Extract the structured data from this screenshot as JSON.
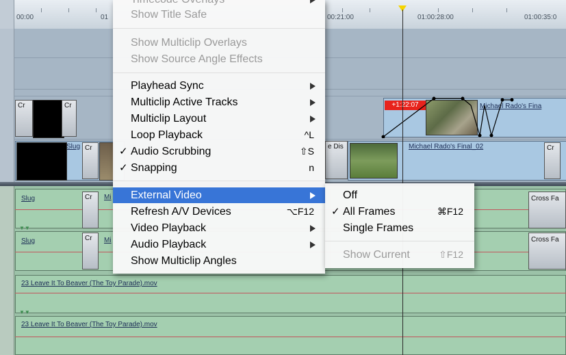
{
  "timeline": {
    "ruler_labels": [
      "00:00",
      "01",
      "00:21:00",
      "01:00:28:00",
      "01:00:35:0"
    ],
    "video_clips": {
      "cr1": "Cr",
      "cr2": "Cr",
      "slug": "Slug",
      "cr3": "Cr",
      "dis": "e Dis",
      "rado1": "Michael Rado's Fina",
      "rado2": "Michael Rado's Final_02",
      "cr4": "Cr",
      "timecode_badge": "+1:22:07"
    },
    "audio_clips": {
      "slug1": "Slug",
      "slug2": "Slug",
      "cr1": "Cr",
      "cr2": "Cr",
      "mi1": "Mi",
      "mi2": "Mi",
      "cross1": "Cross Fa",
      "cross2": "Cross Fa",
      "beaver1": "23 Leave It To Beaver (The Toy Parade).mov",
      "beaver2": "23 Leave It To Beaver (The Toy Parade).mov"
    }
  },
  "view_menu": {
    "partial_top": "Timecode Overlays",
    "items": [
      {
        "label": "Show Title Safe",
        "disabled": true
      },
      {
        "label": "Show Multiclip Overlays",
        "disabled": true
      },
      {
        "label": "Show Source Angle Effects",
        "disabled": true
      },
      {
        "label": "Playhead Sync",
        "submenu": true
      },
      {
        "label": "Multiclip Active Tracks",
        "submenu": true
      },
      {
        "label": "Multiclip Layout",
        "submenu": true
      },
      {
        "label": "Loop Playback",
        "shortcut": "^L"
      },
      {
        "label": "Audio Scrubbing",
        "shortcut": "⇧S",
        "checked": true
      },
      {
        "label": "Snapping",
        "shortcut": "n",
        "checked": true
      },
      {
        "label": "External Video",
        "submenu": true,
        "highlighted": true
      },
      {
        "label": "Refresh A/V Devices",
        "shortcut": "⌥F12"
      },
      {
        "label": "Video Playback",
        "submenu": true
      },
      {
        "label": "Audio Playback",
        "submenu": true
      },
      {
        "label": "Show Multiclip Angles"
      }
    ],
    "check_mark": "✓"
  },
  "external_video_submenu": {
    "items": [
      {
        "label": "Off"
      },
      {
        "label": "All Frames",
        "shortcut": "⌘F12",
        "checked": true
      },
      {
        "label": "Single Frames"
      },
      {
        "label": "Show Current",
        "shortcut": "⇧F12",
        "disabled": true
      }
    ]
  },
  "colors": {
    "menu_highlight": "#3875d7",
    "video_clip": "#a9c8e2",
    "audio_clip": "#a4cfb0",
    "playhead": "#f5d400",
    "timecode_badge": "#e8231c"
  }
}
